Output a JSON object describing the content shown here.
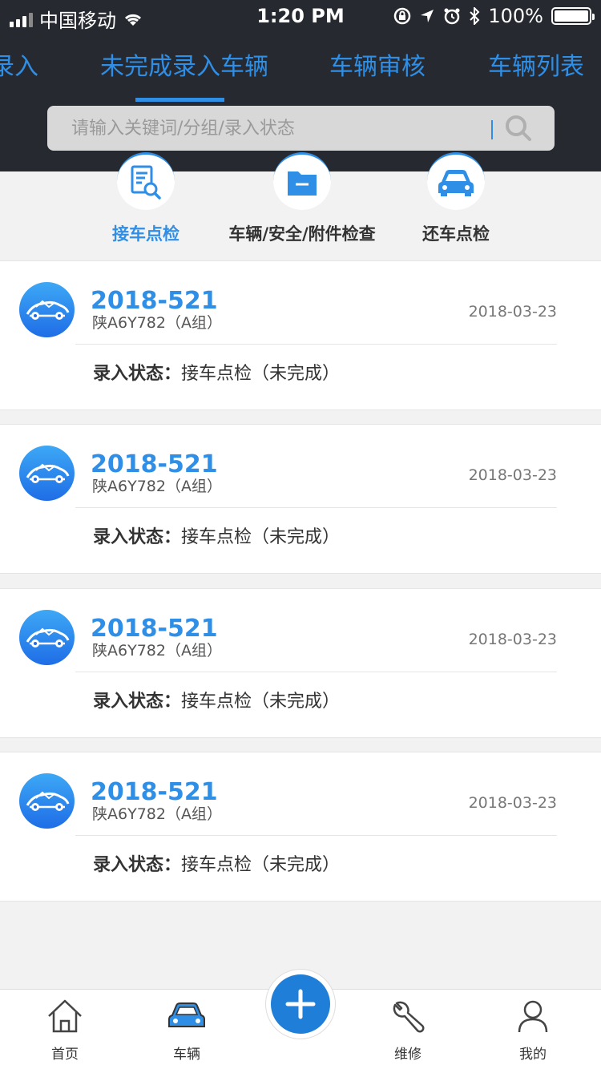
{
  "status_bar": {
    "carrier": "中国移动",
    "time": "1:20 PM",
    "battery": "100%"
  },
  "tabs": [
    {
      "label": "录入"
    },
    {
      "label": "未完成录入车辆"
    },
    {
      "label": "车辆审核"
    },
    {
      "label": "车辆列表"
    }
  ],
  "search": {
    "placeholder": "请输入关键词/分组/录入状态"
  },
  "quick_actions": [
    {
      "label": "接车点检",
      "icon": "document-search-icon"
    },
    {
      "label": "车辆/安全/附件检查",
      "icon": "folder-icon"
    },
    {
      "label": "还车点检",
      "icon": "car-icon"
    }
  ],
  "colors": {
    "accent": "#2f8ee6",
    "header_bg": "#262a30"
  },
  "records": [
    {
      "code": "2018-521",
      "plate": "陕A6Y782（A组）",
      "date": "2018-03-23",
      "state_label": "录入状态：",
      "state_value": "接车点检（未完成）"
    },
    {
      "code": "2018-521",
      "plate": "陕A6Y782（A组）",
      "date": "2018-03-23",
      "state_label": "录入状态：",
      "state_value": "接车点检（未完成）"
    },
    {
      "code": "2018-521",
      "plate": "陕A6Y782（A组）",
      "date": "2018-03-23",
      "state_label": "录入状态：",
      "state_value": "接车点检（未完成）"
    },
    {
      "code": "2018-521",
      "plate": "陕A6Y782（A组）",
      "date": "2018-03-23",
      "state_label": "录入状态：",
      "state_value": "接车点检（未完成）"
    }
  ],
  "tabbar": [
    {
      "label": "首页",
      "icon": "home-icon"
    },
    {
      "label": "车辆",
      "icon": "car-icon"
    },
    {
      "label": "维修",
      "icon": "wrench-icon"
    },
    {
      "label": "我的",
      "icon": "user-icon"
    }
  ]
}
